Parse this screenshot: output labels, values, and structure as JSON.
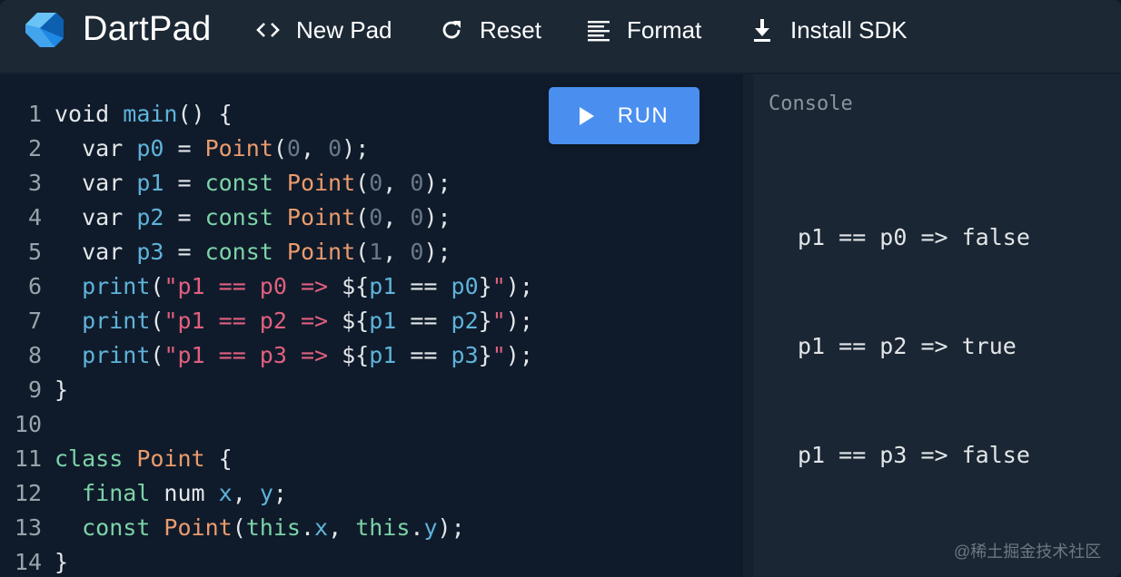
{
  "header": {
    "brand": "DartPad",
    "buttons": {
      "new_pad": "New Pad",
      "reset": "Reset",
      "format": "Format",
      "install_sdk": "Install SDK"
    }
  },
  "editor": {
    "run_label": "RUN",
    "lines": [
      {
        "n": "1",
        "tokens": [
          {
            "t": "void ",
            "c": "tx"
          },
          {
            "t": "main",
            "c": "k-blue"
          },
          {
            "t": "() {",
            "c": "tx"
          }
        ]
      },
      {
        "n": "2",
        "tokens": [
          {
            "t": "  var ",
            "c": "tx"
          },
          {
            "t": "p0",
            "c": "k-blue"
          },
          {
            "t": " = ",
            "c": "tx"
          },
          {
            "t": "Point",
            "c": "k-orange"
          },
          {
            "t": "(",
            "c": "tx"
          },
          {
            "t": "0",
            "c": "k-dim"
          },
          {
            "t": ", ",
            "c": "tx"
          },
          {
            "t": "0",
            "c": "k-dim"
          },
          {
            "t": ");",
            "c": "tx"
          }
        ]
      },
      {
        "n": "3",
        "tokens": [
          {
            "t": "  var ",
            "c": "tx"
          },
          {
            "t": "p1",
            "c": "k-blue"
          },
          {
            "t": " = ",
            "c": "tx"
          },
          {
            "t": "const ",
            "c": "k-green"
          },
          {
            "t": "Point",
            "c": "k-orange"
          },
          {
            "t": "(",
            "c": "tx"
          },
          {
            "t": "0",
            "c": "k-dim"
          },
          {
            "t": ", ",
            "c": "tx"
          },
          {
            "t": "0",
            "c": "k-dim"
          },
          {
            "t": ");",
            "c": "tx"
          }
        ]
      },
      {
        "n": "4",
        "tokens": [
          {
            "t": "  var ",
            "c": "tx"
          },
          {
            "t": "p2",
            "c": "k-blue"
          },
          {
            "t": " = ",
            "c": "tx"
          },
          {
            "t": "const ",
            "c": "k-green"
          },
          {
            "t": "Point",
            "c": "k-orange"
          },
          {
            "t": "(",
            "c": "tx"
          },
          {
            "t": "0",
            "c": "k-dim"
          },
          {
            "t": ", ",
            "c": "tx"
          },
          {
            "t": "0",
            "c": "k-dim"
          },
          {
            "t": ");",
            "c": "tx"
          }
        ]
      },
      {
        "n": "5",
        "tokens": [
          {
            "t": "  var ",
            "c": "tx"
          },
          {
            "t": "p3",
            "c": "k-blue"
          },
          {
            "t": " = ",
            "c": "tx"
          },
          {
            "t": "const ",
            "c": "k-green"
          },
          {
            "t": "Point",
            "c": "k-orange"
          },
          {
            "t": "(",
            "c": "tx"
          },
          {
            "t": "1",
            "c": "k-dim"
          },
          {
            "t": ", ",
            "c": "tx"
          },
          {
            "t": "0",
            "c": "k-dim"
          },
          {
            "t": ");",
            "c": "tx"
          }
        ]
      },
      {
        "n": "6",
        "tokens": [
          {
            "t": "  ",
            "c": "tx"
          },
          {
            "t": "print",
            "c": "k-blue"
          },
          {
            "t": "(",
            "c": "tx"
          },
          {
            "t": "\"p1 == p0 => ",
            "c": "k-pink"
          },
          {
            "t": "${",
            "c": "tx"
          },
          {
            "t": "p1",
            "c": "k-blue"
          },
          {
            "t": " == ",
            "c": "tx"
          },
          {
            "t": "p0",
            "c": "k-blue"
          },
          {
            "t": "}",
            "c": "tx"
          },
          {
            "t": "\"",
            "c": "k-pink"
          },
          {
            "t": ");",
            "c": "tx"
          }
        ]
      },
      {
        "n": "7",
        "tokens": [
          {
            "t": "  ",
            "c": "tx"
          },
          {
            "t": "print",
            "c": "k-blue"
          },
          {
            "t": "(",
            "c": "tx"
          },
          {
            "t": "\"p1 == p2 => ",
            "c": "k-pink"
          },
          {
            "t": "${",
            "c": "tx"
          },
          {
            "t": "p1",
            "c": "k-blue"
          },
          {
            "t": " == ",
            "c": "tx"
          },
          {
            "t": "p2",
            "c": "k-blue"
          },
          {
            "t": "}",
            "c": "tx"
          },
          {
            "t": "\"",
            "c": "k-pink"
          },
          {
            "t": ");",
            "c": "tx"
          }
        ]
      },
      {
        "n": "8",
        "tokens": [
          {
            "t": "  ",
            "c": "tx"
          },
          {
            "t": "print",
            "c": "k-blue"
          },
          {
            "t": "(",
            "c": "tx"
          },
          {
            "t": "\"p1 == p3 => ",
            "c": "k-pink"
          },
          {
            "t": "${",
            "c": "tx"
          },
          {
            "t": "p1",
            "c": "k-blue"
          },
          {
            "t": " == ",
            "c": "tx"
          },
          {
            "t": "p3",
            "c": "k-blue"
          },
          {
            "t": "}",
            "c": "tx"
          },
          {
            "t": "\"",
            "c": "k-pink"
          },
          {
            "t": ");",
            "c": "tx"
          }
        ]
      },
      {
        "n": "9",
        "tokens": [
          {
            "t": "}",
            "c": "tx"
          }
        ]
      },
      {
        "n": "10",
        "tokens": []
      },
      {
        "n": "11",
        "tokens": [
          {
            "t": "class ",
            "c": "k-green"
          },
          {
            "t": "Point",
            "c": "k-orange"
          },
          {
            "t": " {",
            "c": "tx"
          }
        ]
      },
      {
        "n": "12",
        "tokens": [
          {
            "t": "  final ",
            "c": "k-green"
          },
          {
            "t": "num ",
            "c": "tx"
          },
          {
            "t": "x",
            "c": "k-blue"
          },
          {
            "t": ", ",
            "c": "tx"
          },
          {
            "t": "y",
            "c": "k-blue"
          },
          {
            "t": ";",
            "c": "tx"
          }
        ]
      },
      {
        "n": "13",
        "tokens": [
          {
            "t": "  const ",
            "c": "k-green"
          },
          {
            "t": "Point",
            "c": "k-orange"
          },
          {
            "t": "(",
            "c": "tx"
          },
          {
            "t": "this",
            "c": "k-green"
          },
          {
            "t": ".",
            "c": "tx"
          },
          {
            "t": "x",
            "c": "k-blue"
          },
          {
            "t": ", ",
            "c": "tx"
          },
          {
            "t": "this",
            "c": "k-green"
          },
          {
            "t": ".",
            "c": "tx"
          },
          {
            "t": "y",
            "c": "k-blue"
          },
          {
            "t": ");",
            "c": "tx"
          }
        ]
      },
      {
        "n": "14",
        "tokens": [
          {
            "t": "}",
            "c": "tx"
          }
        ]
      }
    ]
  },
  "console": {
    "title": "Console",
    "output": [
      "p1 == p0 => false",
      "p1 == p2 => true",
      "p1 == p3 => false"
    ]
  },
  "watermark": "@稀土掘金技术社区",
  "colors": {
    "accent": "#4a8ff0",
    "header_bg": "#1c2834",
    "editor_bg": "#0f1b2b",
    "console_bg": "#1a2633"
  }
}
